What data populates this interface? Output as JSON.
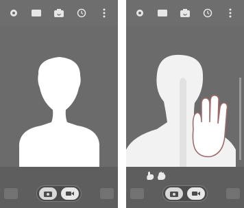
{
  "screens": [
    {
      "id": "before",
      "top_bar_icons": [
        "settings-icon",
        "ratio-icon",
        "switch-camera-icon",
        "timer-icon",
        "more-icon"
      ],
      "viewfinder": {
        "subject": "person-silhouette"
      },
      "bottom_bar": {
        "modes": [
          "photo-mode-icon",
          "video-mode-icon"
        ]
      }
    },
    {
      "id": "after",
      "top_bar_icons": [
        "settings-icon",
        "ratio-icon",
        "switch-camera-icon",
        "timer-icon",
        "more-icon"
      ],
      "viewfinder": {
        "subject": "person-raising-palm",
        "gesture": "palm-icon"
      },
      "bottom_bar": {
        "modes": [
          "photo-mode-icon",
          "video-mode-icon"
        ],
        "gesture_hints": [
          "fist-icon",
          "open-palm-icon"
        ]
      }
    }
  ],
  "colors": {
    "screen_bg": "#6e6e6e",
    "bottom_bar": "#5e5e5e",
    "icon": "#e6e6e6",
    "silhouette": "#ffffff"
  }
}
